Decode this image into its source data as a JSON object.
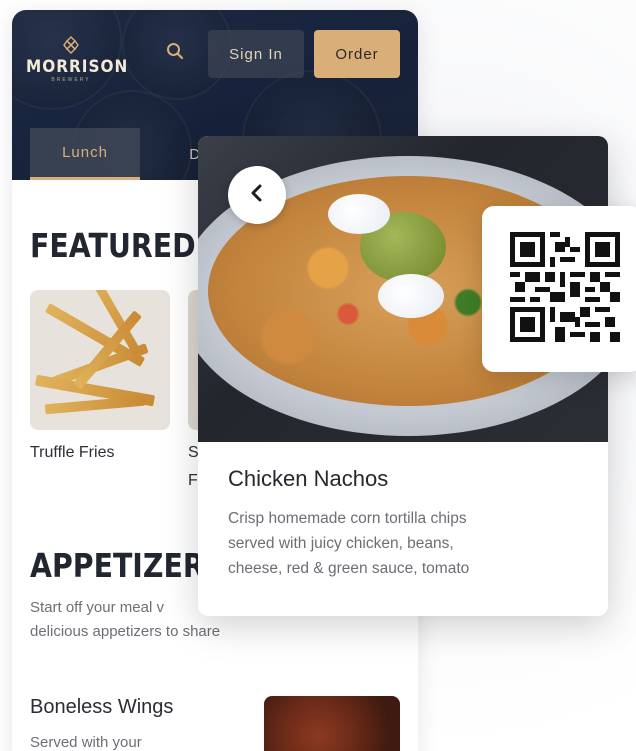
{
  "header": {
    "brand_name": "MORRISON",
    "brand_sub": "BREWERY",
    "signin_label": "Sign In",
    "order_label": "Order"
  },
  "tabs": [
    {
      "label": "Lunch",
      "active": true
    },
    {
      "label": "Din",
      "active": false
    }
  ],
  "featured": {
    "title": "FEATURED",
    "items": [
      {
        "label": "Truffle Fries"
      },
      {
        "label_line1": "S",
        "label_line2": "F"
      }
    ]
  },
  "appetizers": {
    "title": "APPETIZER",
    "description_line1": "Start off your meal v",
    "description_line2": "delicious appetizers to share",
    "items": [
      {
        "name": "Boneless Wings",
        "description": "Served with your"
      }
    ]
  },
  "detail_card": {
    "title": "Chicken Nachos",
    "description_lines": [
      "Crisp homemade corn tortilla chips",
      "served with juicy chicken, beans,",
      "cheese, red & green sauce, tomato"
    ]
  },
  "icons": {
    "search": "search-icon",
    "back": "chevron-left-icon",
    "qr": "qr-code-icon",
    "logo_mark": "hop-icon"
  },
  "colors": {
    "accent": "#d9ae78",
    "header_bg": "#1d2a44",
    "title_text": "#222630",
    "body_text": "#6d6f76"
  }
}
